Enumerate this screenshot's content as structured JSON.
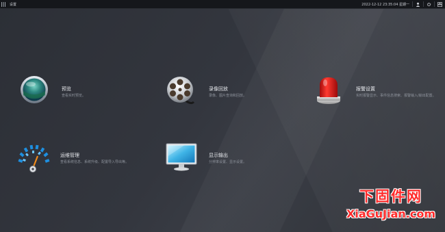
{
  "topbar": {
    "title": "设置",
    "datetime": "2022-12-12 23:35:04 星期一",
    "icons": [
      "grid-icon",
      "user-icon",
      "power-icon",
      "layout-icon"
    ]
  },
  "tiles": [
    {
      "icon": "preview-lens-icon",
      "name": "预览",
      "desc": "查看实时预览。"
    },
    {
      "icon": "film-reel-icon",
      "name": "录像回放",
      "desc": "录像、图片查询和回放。"
    },
    {
      "icon": "alarm-siren-icon",
      "name": "报警设置",
      "desc": "实时报警显示、事件信息搜索、报警输入/输出配置。"
    },
    {
      "icon": "gauge-icon",
      "name": "运维管理",
      "desc": "查看系统信息、系统升级、配置导入导出等。"
    },
    {
      "icon": "monitor-icon",
      "name": "显示输出",
      "desc": "分辨率设置、显示设置。"
    }
  ],
  "watermark": {
    "cn": "下固件网",
    "en": "XiaGuJian.com"
  },
  "colors": {
    "topbar_bg": "#15171b",
    "watermark": "#ff2b2b"
  }
}
